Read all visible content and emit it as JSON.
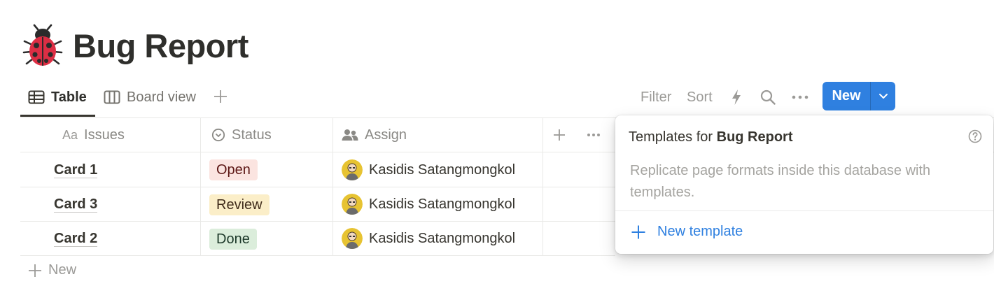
{
  "page": {
    "title": "Bug Report"
  },
  "tabs": [
    {
      "label": "Table",
      "active": true
    },
    {
      "label": "Board view",
      "active": false
    }
  ],
  "toolbar": {
    "filter": "Filter",
    "sort": "Sort",
    "new_button": "New"
  },
  "table": {
    "columns": [
      "Issues",
      "Status",
      "Assign"
    ],
    "rows": [
      {
        "name": "Card 1",
        "status": "Open",
        "assignee": "Kasidis Satangmongkol"
      },
      {
        "name": "Card 3",
        "status": "Review",
        "assignee": "Kasidis Satangmongkol"
      },
      {
        "name": "Card 2",
        "status": "Done",
        "assignee": "Kasidis Satangmongkol"
      }
    ],
    "new_row": "New"
  },
  "status_colors": {
    "Open": {
      "bg": "#fbe4e0",
      "fg": "#5d1715"
    },
    "Review": {
      "bg": "#fbeec8",
      "fg": "#402c1b"
    },
    "Done": {
      "bg": "#dbeddb",
      "fg": "#1c3829"
    }
  },
  "popover": {
    "title_prefix": "Templates for",
    "title_bold": "Bug Report",
    "description": "Replicate page formats inside this database with templates.",
    "new_template": "New template"
  },
  "colors": {
    "accent": "#2f80e0"
  }
}
